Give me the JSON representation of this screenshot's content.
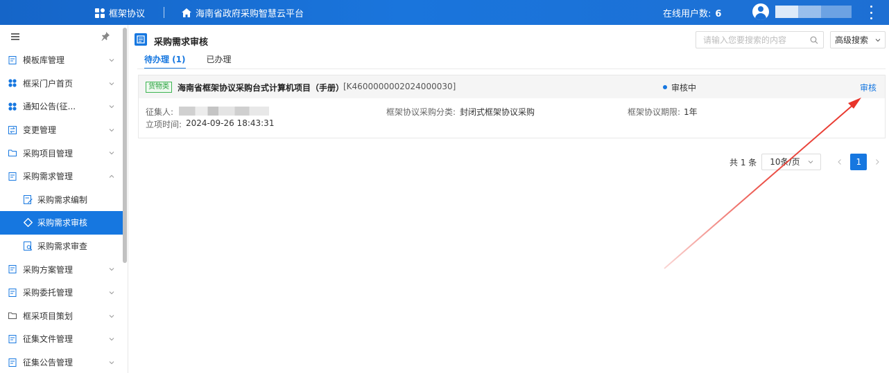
{
  "topbar": {
    "app_name": "框架协议",
    "platform_name": "海南省政府采购智慧云平台",
    "online_label": "在线用户数:",
    "online_count": "6"
  },
  "sidebar": {
    "items": [
      {
        "label": "模板库管理",
        "expanded": false
      },
      {
        "label": "框采门户首页",
        "expanded": false
      },
      {
        "label": "通知公告(征...",
        "expanded": false
      },
      {
        "label": "变更管理",
        "expanded": false
      },
      {
        "label": "采购项目管理",
        "expanded": false
      },
      {
        "label": "采购需求管理",
        "expanded": true,
        "children": [
          {
            "label": "采购需求编制"
          },
          {
            "label": "采购需求审核",
            "active": true
          },
          {
            "label": "采购需求审查"
          }
        ]
      },
      {
        "label": "采购方案管理",
        "expanded": false
      },
      {
        "label": "采购委托管理",
        "expanded": false
      },
      {
        "label": "框采项目策划",
        "expanded": false
      },
      {
        "label": "征集文件管理",
        "expanded": false
      },
      {
        "label": "征集公告管理",
        "expanded": false
      }
    ]
  },
  "main": {
    "title": "采购需求审核",
    "search": {
      "placeholder": "请输入您要搜索的内容"
    },
    "advanced_search": "高级搜索",
    "tabs": [
      {
        "label": "待办理 (1)",
        "active": true
      },
      {
        "label": "已办理",
        "active": false
      }
    ],
    "card": {
      "tag": "货物类",
      "project_name": "海南省框架协议采购台式计算机项目（手册）",
      "project_code": "[K4600000002024000030]",
      "status": "审核中",
      "action": "审核",
      "collector_label": "征集人:",
      "category_label": "框架协议采购分类:",
      "category_value": "封闭式框架协议采购",
      "term_label": "框架协议期限:",
      "term_value": "1年",
      "created_label": "立项时间:",
      "created_value": "2024-09-26 18:43:31"
    },
    "pagination": {
      "total": "共 1 条",
      "page_size": "10条/页",
      "current_page": "1"
    }
  },
  "colors": {
    "primary": "#1677e0",
    "topbar": "#1a6fd5",
    "tag_green": "#2aa23e",
    "annotation_arrow": "#e8342a"
  }
}
